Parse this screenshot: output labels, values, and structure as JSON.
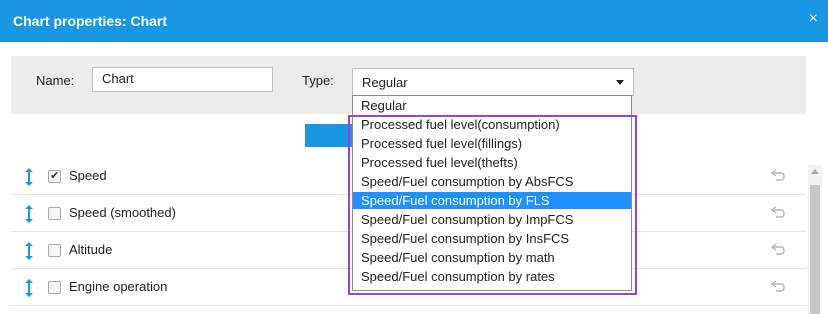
{
  "dialog": {
    "title": "Chart properties: Chart",
    "close_symbol": "×",
    "title_bar_color": "#1a96e3"
  },
  "form": {
    "name_label": "Name:",
    "name_value": "Chart",
    "type_label": "Type:",
    "type_value": "Regular"
  },
  "type_dropdown": {
    "options": [
      "Regular",
      "Processed fuel level(consumption)",
      "Processed fuel level(fillings)",
      "Processed fuel level(thefts)",
      "Speed/Fuel consumption by AbsFCS",
      "Speed/Fuel consumption by FLS",
      "Speed/Fuel consumption by ImpFCS",
      "Speed/Fuel consumption by InsFCS",
      "Speed/Fuel consumption by math",
      "Speed/Fuel consumption by rates"
    ],
    "hovered_option": "Speed/Fuel consumption by FLS",
    "highlight_color": "#1e90ff",
    "annotation_box_color": "#9c3fd8"
  },
  "series": [
    {
      "label": "Speed",
      "checked": true
    },
    {
      "label": "Speed (smoothed)",
      "checked": false
    },
    {
      "label": "Altitude",
      "checked": false
    },
    {
      "label": "Engine operation",
      "checked": false
    }
  ],
  "icons": {
    "close": "close-icon",
    "drag": "drag-handle-icon",
    "checkbox": "checkbox-icon",
    "reset": "undo-icon",
    "dropdown": "chevron-down-icon"
  }
}
